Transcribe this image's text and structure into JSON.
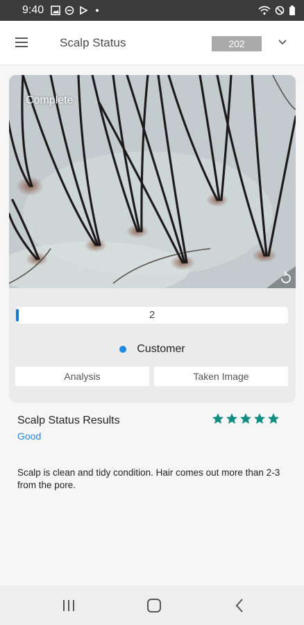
{
  "status_bar": {
    "time": "9:40"
  },
  "app_bar": {
    "title": "Scalp Status",
    "device_id": "202"
  },
  "image_panel": {
    "status_label": "Complete"
  },
  "progress": {
    "value_text": "2",
    "fill_fraction": 0.01,
    "accent_color": "#1976d2"
  },
  "customer": {
    "label": "Customer",
    "dot_color": "#1e88e5"
  },
  "tabs": [
    {
      "label": "Analysis"
    },
    {
      "label": "Taken Image"
    }
  ],
  "results": {
    "title": "Scalp Status Results",
    "grade": "Good",
    "grade_color": "#1e88e5",
    "rating": 5,
    "rating_max": 5,
    "star_color": "#138d82",
    "description": "Scalp is clean and tidy condition. Hair comes out more than 2-3 from the pore."
  },
  "icons": {
    "menu": "hamburger-icon",
    "dropdown": "chevron-down-icon",
    "rotate": "rotate-icon",
    "nav": [
      "recents-icon",
      "home-icon",
      "back-icon"
    ]
  }
}
